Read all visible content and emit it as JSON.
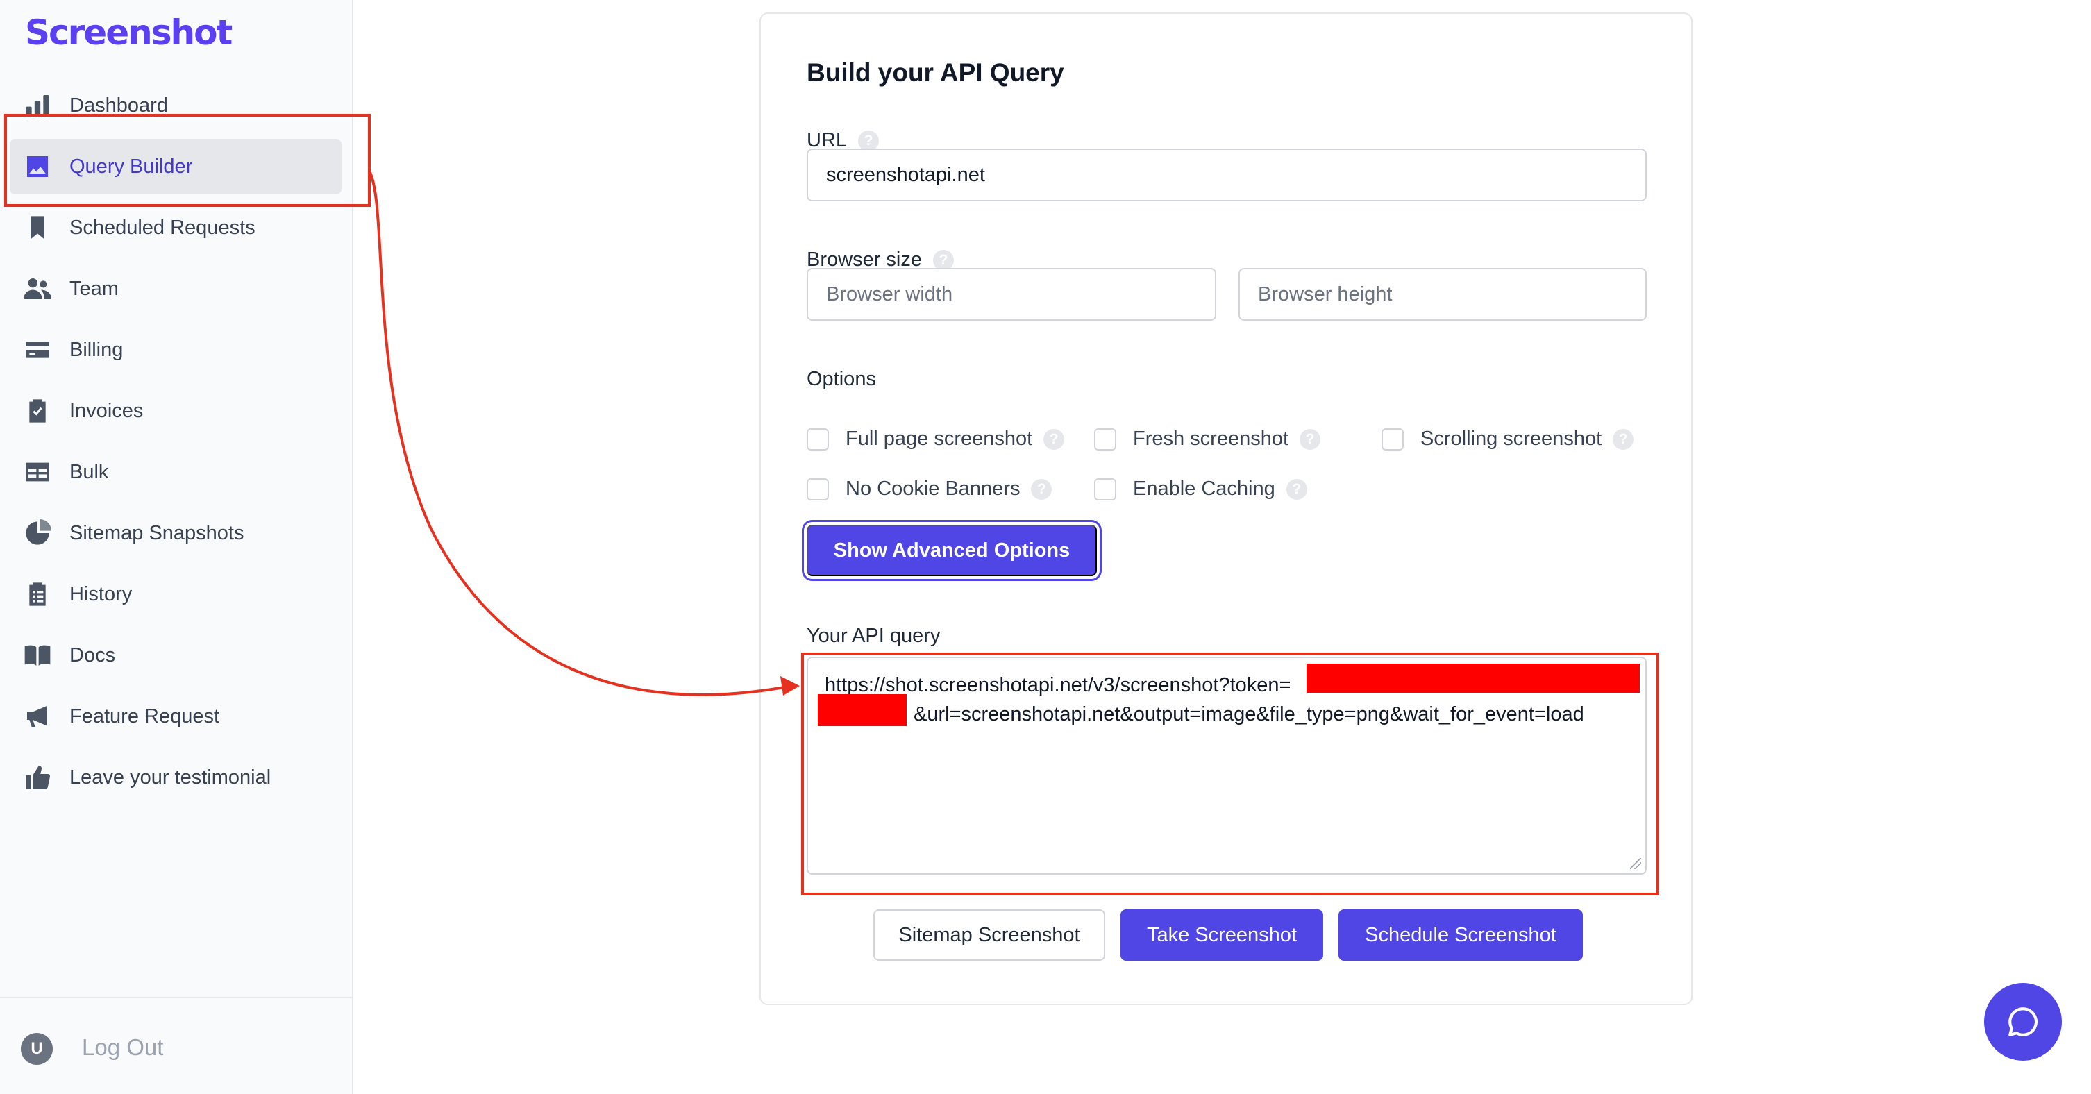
{
  "brand": "Screenshot",
  "sidebar": {
    "items": [
      {
        "label": "Dashboard",
        "icon": "bar-chart-icon"
      },
      {
        "label": "Query Builder",
        "icon": "image-icon",
        "active": true
      },
      {
        "label": "Scheduled Requests",
        "icon": "bookmark-icon"
      },
      {
        "label": "Team",
        "icon": "users-icon"
      },
      {
        "label": "Billing",
        "icon": "credit-card-icon"
      },
      {
        "label": "Invoices",
        "icon": "clipboard-check-icon"
      },
      {
        "label": "Bulk",
        "icon": "table-icon"
      },
      {
        "label": "Sitemap Snapshots",
        "icon": "pie-chart-icon"
      },
      {
        "label": "History",
        "icon": "clipboard-list-icon"
      },
      {
        "label": "Docs",
        "icon": "book-open-icon"
      },
      {
        "label": "Feature Request",
        "icon": "megaphone-icon"
      },
      {
        "label": "Leave your testimonial",
        "icon": "thumbs-up-icon"
      }
    ],
    "footer": {
      "avatar_initial": "U",
      "logout_label": "Log Out"
    }
  },
  "builder": {
    "title": "Build your API Query",
    "url_label": "URL",
    "url_value": "screenshotapi.net",
    "browser_size_label": "Browser size",
    "width_placeholder": "Browser width",
    "height_placeholder": "Browser height",
    "options_label": "Options",
    "options": [
      {
        "label": "Full page screenshot",
        "checked": false
      },
      {
        "label": "Fresh screenshot",
        "checked": false
      },
      {
        "label": "Scrolling screenshot",
        "checked": false
      },
      {
        "label": "No Cookie Banners",
        "checked": false
      },
      {
        "label": "Enable Caching",
        "checked": false
      }
    ],
    "advanced_button": "Show Advanced Options",
    "query_label": "Your API query",
    "query_line1": "https://shot.screenshotapi.net/v3/screenshot?token=",
    "query_line2": "&url=screenshotapi.net&output=image&file_type=png&wait_for_event=load",
    "buttons": {
      "sitemap": "Sitemap Screenshot",
      "take": "Take Screenshot",
      "schedule": "Schedule Screenshot"
    }
  },
  "colors": {
    "accent": "#4f46e5",
    "brand": "#5b3ff0",
    "annotation": "#e5311f",
    "redaction": "#ff0000"
  }
}
